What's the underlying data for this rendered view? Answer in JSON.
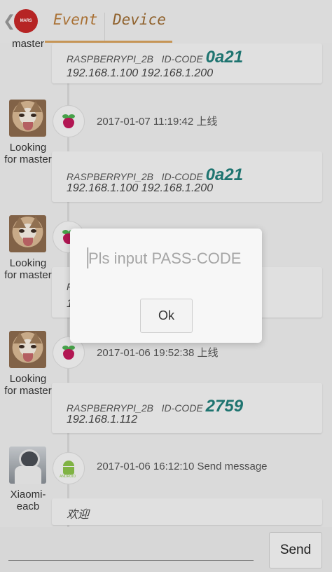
{
  "header": {
    "back_icon": "chevron-left-icon",
    "logo_text": "MARS",
    "tabs": [
      {
        "label": "Event"
      },
      {
        "label": "Device"
      }
    ]
  },
  "events": [
    {
      "user": {
        "name": "master",
        "avatar": "cat-avatar"
      },
      "card": {
        "model": "RASPBERRYPI_2B",
        "code_label": "ID-CODE",
        "code": "0a21",
        "ips": "192.168.1.100 192.168.1.200"
      }
    },
    {
      "user": {
        "name": "Looking for master",
        "avatar": "cat-avatar"
      },
      "icon": "raspberry-pi-icon",
      "time": "2017-01-07 11:19:42 上线",
      "card": {
        "model": "RASPBERRYPI_2B",
        "code_label": "ID-CODE",
        "code": "0a21",
        "ips": "192.168.1.100 192.168.1.200"
      }
    },
    {
      "user": {
        "name": "Looking for master",
        "avatar": "cat-avatar"
      },
      "icon": "raspberry-pi-icon",
      "card": {
        "model_partial": "F",
        "ips_partial": "1"
      }
    },
    {
      "user": {
        "name": "Looking for master",
        "avatar": "cat-avatar"
      },
      "icon": "raspberry-pi-icon",
      "time": "2017-01-06 19:52:38 上线",
      "card": {
        "model": "RASPBERRYPI_2B",
        "code_label": "ID-CODE",
        "code": "2759",
        "ips": "192.168.1.112"
      }
    },
    {
      "user": {
        "name": "Xiaomi-eacb",
        "avatar": "astronaut-avatar"
      },
      "icon": "android-icon",
      "time": "2017-01-06 16:12:10 Send message",
      "card": {
        "message": "欢迎"
      }
    }
  ],
  "dialog": {
    "placeholder": "Pls input PASS-CODE",
    "value": "",
    "ok_label": "Ok"
  },
  "bottom": {
    "input_value": "",
    "send_label": "Send"
  },
  "colors": {
    "accent": "#d7a25e",
    "code": "#217e7a",
    "tab_text": "#b87b3a"
  }
}
